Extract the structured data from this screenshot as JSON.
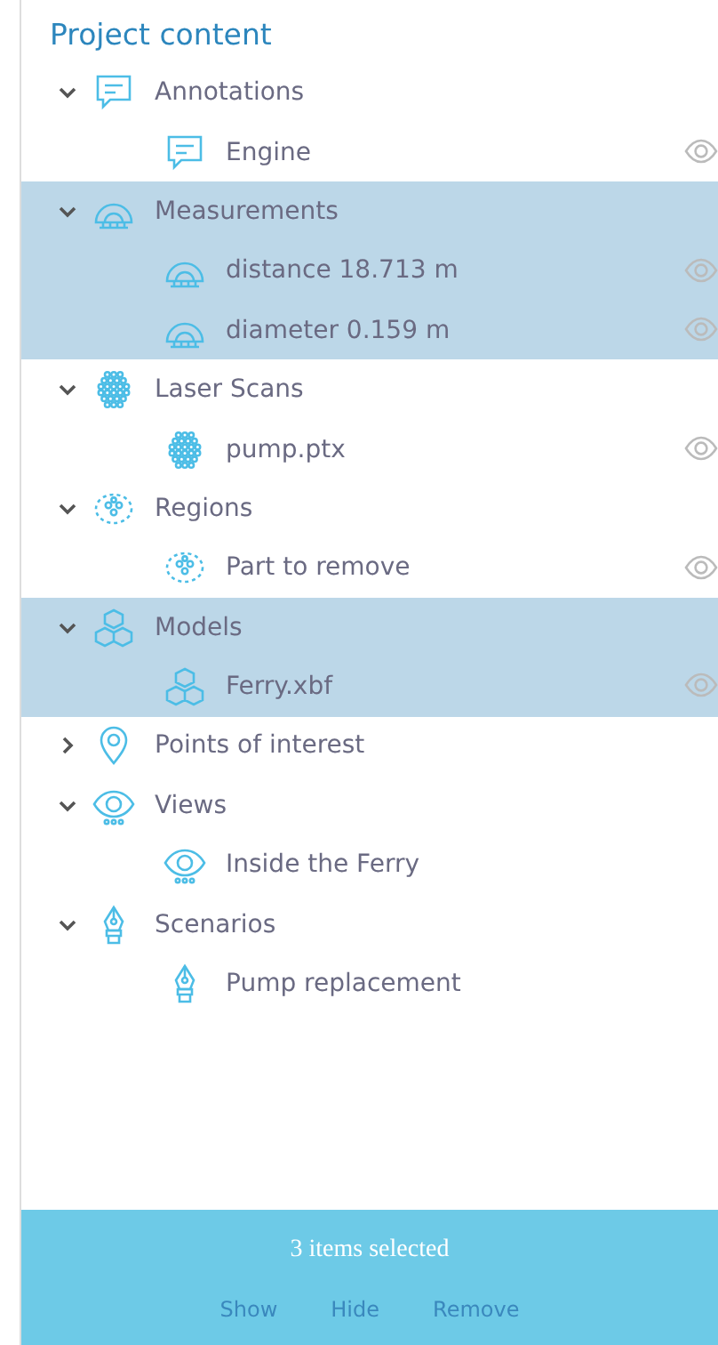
{
  "title": "Project content",
  "groups": [
    {
      "kind": "annotation",
      "label": "Annotations",
      "expanded": true,
      "selected": false,
      "children": [
        {
          "label": "Engine",
          "visible": true
        }
      ]
    },
    {
      "kind": "measurement",
      "label": "Measurements",
      "expanded": true,
      "selected": true,
      "children": [
        {
          "label": "distance 18.713 m",
          "visible": true
        },
        {
          "label": "diameter 0.159 m",
          "visible": true
        }
      ]
    },
    {
      "kind": "scan",
      "label": "Laser Scans",
      "expanded": true,
      "selected": false,
      "children": [
        {
          "label": "pump.ptx",
          "visible": true
        }
      ]
    },
    {
      "kind": "region",
      "label": "Regions",
      "expanded": true,
      "selected": false,
      "children": [
        {
          "label": "Part to remove",
          "visible": true
        }
      ]
    },
    {
      "kind": "model",
      "label": "Models",
      "expanded": true,
      "selected": true,
      "children": [
        {
          "label": "Ferry.xbf",
          "visible": true
        }
      ]
    },
    {
      "kind": "poi",
      "label": "Points of interest",
      "expanded": false,
      "selected": false
    },
    {
      "kind": "view",
      "label": "Views",
      "expanded": true,
      "selected": false,
      "children": [
        {
          "label": "Inside the Ferry"
        }
      ]
    },
    {
      "kind": "scenario",
      "label": "Scenarios",
      "expanded": true,
      "selected": false,
      "children": [
        {
          "label": "Pump replacement"
        }
      ]
    }
  ],
  "selection": {
    "summary": "3 items selected",
    "actions": [
      "Show",
      "Hide",
      "Remove"
    ]
  }
}
